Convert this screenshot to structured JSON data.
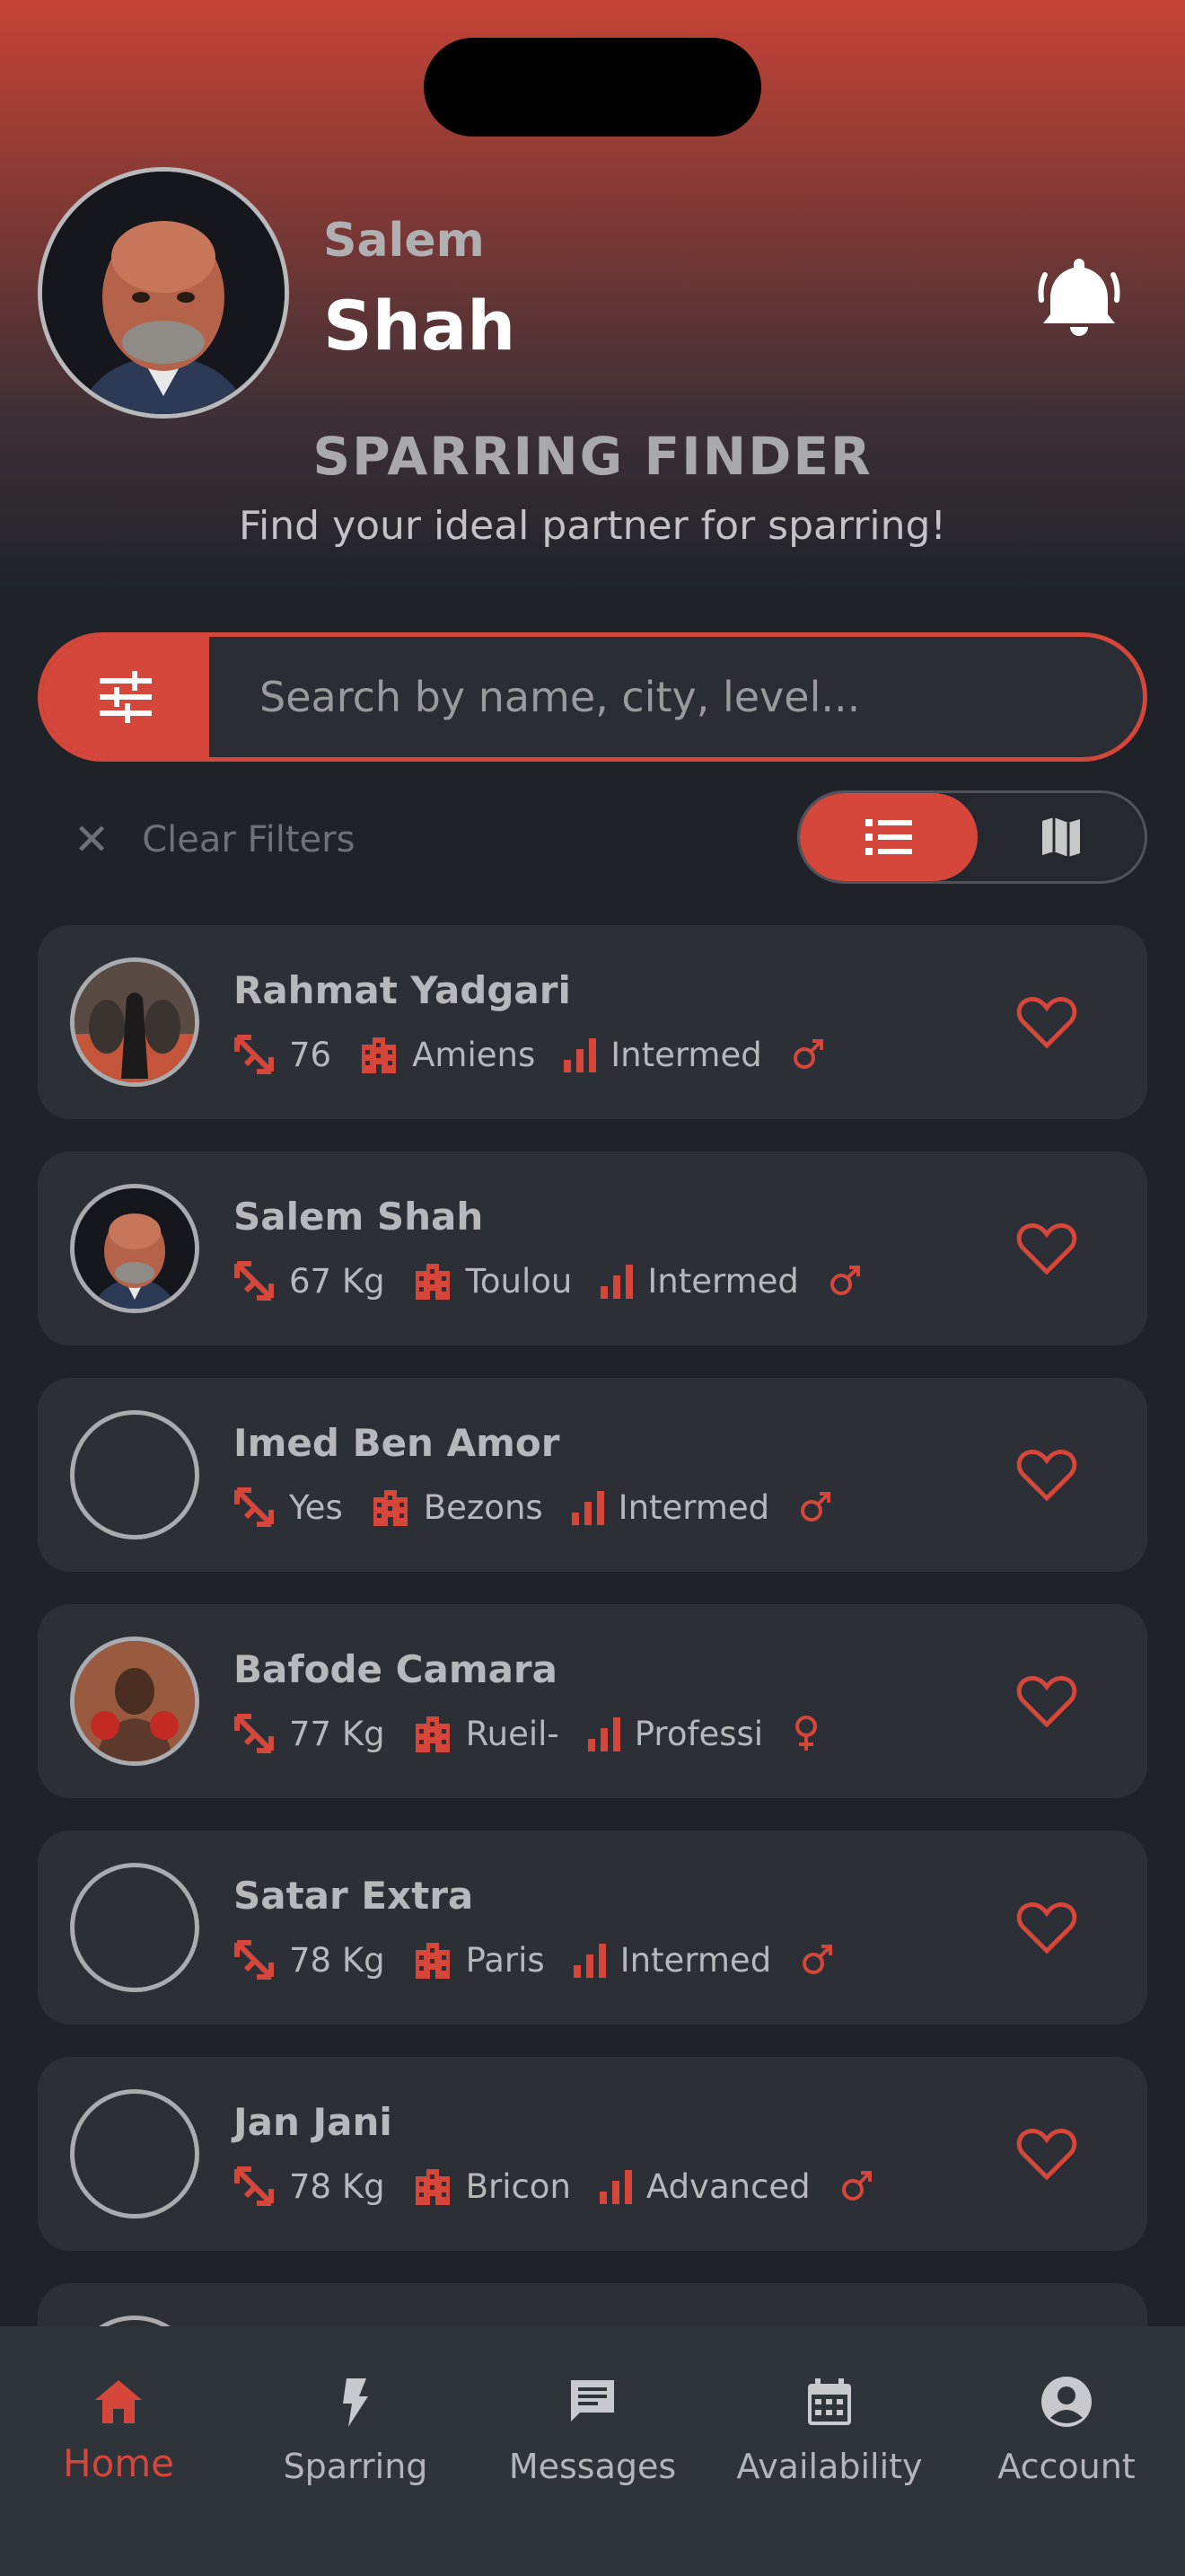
{
  "profile": {
    "first_name": "Salem",
    "last_name": "Shah"
  },
  "header": {
    "title": "SPARRING FINDER",
    "subtitle": "Find your ideal partner for sparring!"
  },
  "search": {
    "placeholder": "Search by name, city, level..."
  },
  "filters": {
    "clear_label": "Clear Filters"
  },
  "view_toggle": {
    "active": "list"
  },
  "colors": {
    "accent": "#d4473a",
    "background": "#1f2329",
    "card": "#2c3036"
  },
  "partners": [
    {
      "name": "Rahmat Yadgari",
      "weight": "76",
      "city": "Amiens",
      "level": "Intermed",
      "gender": "male"
    },
    {
      "name": "Salem Shah",
      "weight": "67 Kg",
      "city": "Toulou",
      "level": "Intermed",
      "gender": "male"
    },
    {
      "name": "Imed Ben Amor",
      "weight": "Yes",
      "city": "Bezons",
      "level": "Intermed",
      "gender": "male"
    },
    {
      "name": "Bafode Camara",
      "weight": "77 Kg",
      "city": "Rueil-",
      "level": "Professi",
      "gender": "female"
    },
    {
      "name": "Satar Extra",
      "weight": "78 Kg",
      "city": "Paris",
      "level": "Intermed",
      "gender": "male"
    },
    {
      "name": "Jan Jani",
      "weight": "78 Kg",
      "city": "Bricon",
      "level": "Advanced",
      "gender": "male"
    }
  ],
  "nav": {
    "home": "Home",
    "sparring": "Sparring",
    "messages": "Messages",
    "availability": "Availability",
    "account": "Account"
  }
}
